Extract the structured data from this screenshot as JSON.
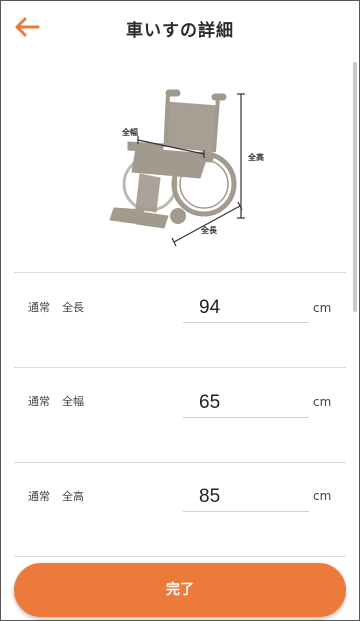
{
  "header": {
    "title": "車いすの詳細"
  },
  "figure": {
    "width_label": "全幅",
    "height_label": "全高",
    "length_label": "全長"
  },
  "rows": [
    {
      "mode": "通常",
      "name": "全長",
      "value": "94",
      "unit": "cm"
    },
    {
      "mode": "通常",
      "name": "全幅",
      "value": "65",
      "unit": "cm"
    },
    {
      "mode": "通常",
      "name": "全高",
      "value": "85",
      "unit": "cm"
    }
  ],
  "footer": {
    "done_label": "完了"
  },
  "colors": {
    "accent": "#eb7a3b",
    "wheelchair": "#a39a8e"
  }
}
